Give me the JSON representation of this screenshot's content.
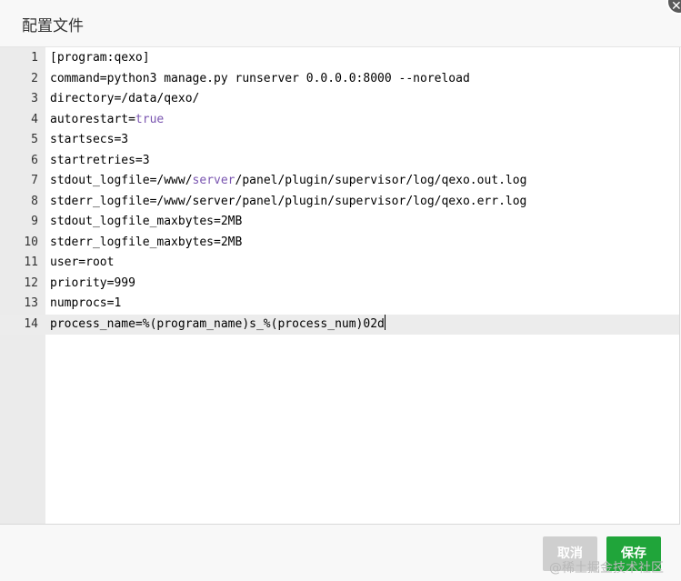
{
  "dialog": {
    "title": "配置文件",
    "close_icon": "close-icon"
  },
  "editor": {
    "lines": [
      {
        "num": "1",
        "text": "[program:qexo]"
      },
      {
        "num": "2",
        "text": "command=python3 manage.py runserver 0.0.0.0:8000 --noreload"
      },
      {
        "num": "3",
        "text": "directory=/data/qexo/"
      },
      {
        "num": "4",
        "pre": "autorestart=",
        "kw": "true"
      },
      {
        "num": "5",
        "text": "startsecs=3"
      },
      {
        "num": "6",
        "text": "startretries=3"
      },
      {
        "num": "7",
        "pre": "stdout_logfile=/www/",
        "kw": "server",
        "post": "/panel/plugin/supervisor/log/qexo.out.log"
      },
      {
        "num": "8",
        "text": "stderr_logfile=/www/server/panel/plugin/supervisor/log/qexo.err.log"
      },
      {
        "num": "9",
        "text": "stdout_logfile_maxbytes=2MB"
      },
      {
        "num": "10",
        "text": "stderr_logfile_maxbytes=2MB"
      },
      {
        "num": "11",
        "text": "user=root"
      },
      {
        "num": "12",
        "text": "priority=999"
      },
      {
        "num": "13",
        "text": "numprocs=1"
      },
      {
        "num": "14",
        "text": "process_name=%(program_name)s_%(process_num)02d"
      }
    ],
    "active_line": "14"
  },
  "footer": {
    "cancel_label": "取消",
    "save_label": "保存",
    "colors": {
      "save": "#20a53a",
      "cancel": "#cfcfcf"
    }
  },
  "watermark": "@稀土掘金技术社区"
}
